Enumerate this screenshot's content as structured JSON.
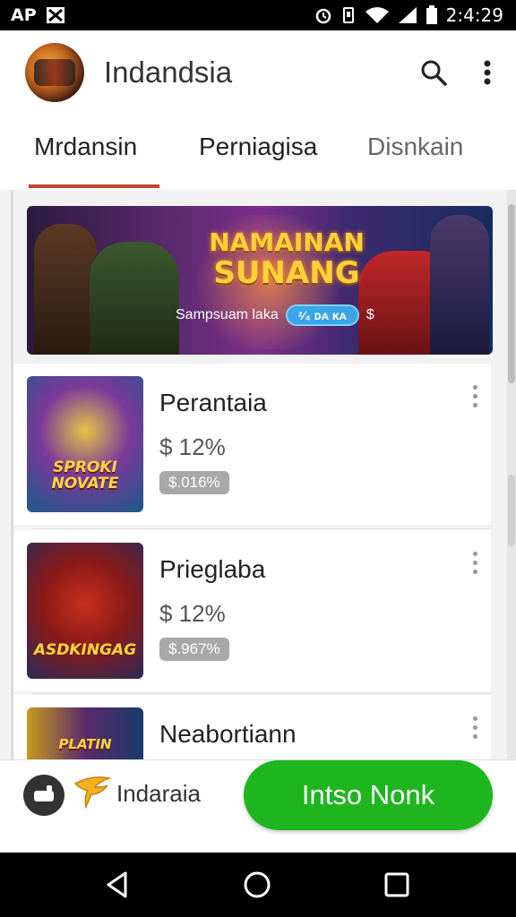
{
  "status_bar": {
    "left_text": "AP",
    "time": "2:4:29"
  },
  "app_bar": {
    "title": "Indandsia"
  },
  "tabs": [
    {
      "label": "Mrdansin",
      "selected": true
    },
    {
      "label": "Perniagisa",
      "selected": false
    },
    {
      "label": "Disnkain",
      "selected": false
    }
  ],
  "banner": {
    "title_line1": "NAMAINAN",
    "title_line2": "SUNANG",
    "subtitle": "Sampsuam laka",
    "pill": "ᶻ⁄₄ ᴅᴀ ᴋᴀ"
  },
  "items": [
    {
      "name": "Perantaia",
      "price": "$ 12%",
      "badge": "$.016%",
      "thumb_label": "SPROKI NOVATE"
    },
    {
      "name": "Prieglaba",
      "price": "$ 12%",
      "badge": "$.967%",
      "thumb_label": "ASDKINGAG"
    },
    {
      "name": "Neabortiann",
      "price": "",
      "badge": "",
      "thumb_label": "PLATIN"
    }
  ],
  "bottom_bar": {
    "label": "Indaraia",
    "cta": "Intso Nonk"
  },
  "colors": {
    "accent": "#c1442d",
    "cta": "#1fb51f",
    "badge": "#a8a8a8"
  }
}
